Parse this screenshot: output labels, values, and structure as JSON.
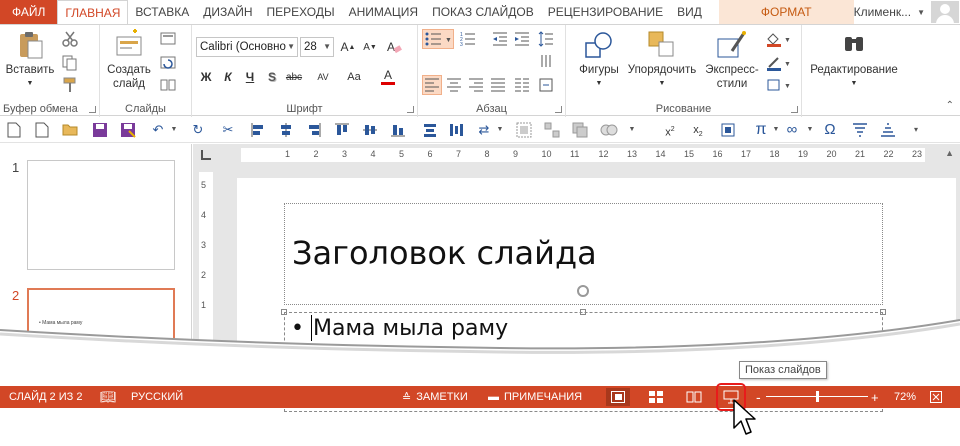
{
  "tabs": {
    "file": "ФАЙЛ",
    "items": [
      "ГЛАВНАЯ",
      "ВСТАВКА",
      "ДИЗАЙН",
      "ПЕРЕХОДЫ",
      "АНИМАЦИЯ",
      "ПОКАЗ СЛАЙДОВ",
      "РЕЦЕНЗИРОВАНИЕ",
      "ВИД"
    ],
    "active": "ГЛАВНАЯ",
    "contextual": "ФОРМАТ"
  },
  "user": {
    "name": "Клименк..."
  },
  "ribbon": {
    "clipboard": {
      "label": "Буфер обмена",
      "paste": "Вставить"
    },
    "slides": {
      "label": "Слайды",
      "new_slide": "Создать",
      "new_slide_2": "слайд"
    },
    "font": {
      "label": "Шрифт",
      "font_name": "Calibri (Основно",
      "font_size": "28",
      "bold": "Ж",
      "italic": "К",
      "underline": "Ч",
      "strike": "abc",
      "spacing": "AV",
      "case": "Aa",
      "color": "A"
    },
    "paragraph": {
      "label": "Абзац"
    },
    "drawing": {
      "label": "Рисование",
      "shapes": "Фигуры",
      "arrange": "Упорядочить",
      "quick_styles": "Экспресс-",
      "quick_styles_2": "стили"
    },
    "editing": {
      "label": "Редактирование"
    }
  },
  "ruler": {
    "h_ticks": [
      "1",
      "2",
      "3",
      "4",
      "5",
      "6",
      "7",
      "8",
      "9",
      "10",
      "11",
      "12",
      "13",
      "14",
      "15",
      "16",
      "17",
      "18",
      "19",
      "20",
      "21",
      "22",
      "23"
    ],
    "v_ticks": [
      "5",
      "4",
      "3",
      "2",
      "1"
    ]
  },
  "thumbnails": [
    {
      "number": "1",
      "text": ""
    },
    {
      "number": "2",
      "text": "• Мама мыла раму"
    }
  ],
  "slide": {
    "title": "Заголовок слайда",
    "bullet": "Мама мыла раму"
  },
  "status": {
    "slide_info": "СЛАЙД 2 ИЗ 2",
    "language": "РУССКИЙ",
    "notes": "ЗАМЕТКИ",
    "comments": "ПРИМЕЧАНИЯ",
    "zoom": "72%",
    "zoom_level": 0.5
  },
  "tooltip": {
    "text": "Показ слайдов"
  },
  "colors": {
    "accent": "#D24726",
    "highlight": "#FBD9C4",
    "ring": "#E81B1B"
  }
}
